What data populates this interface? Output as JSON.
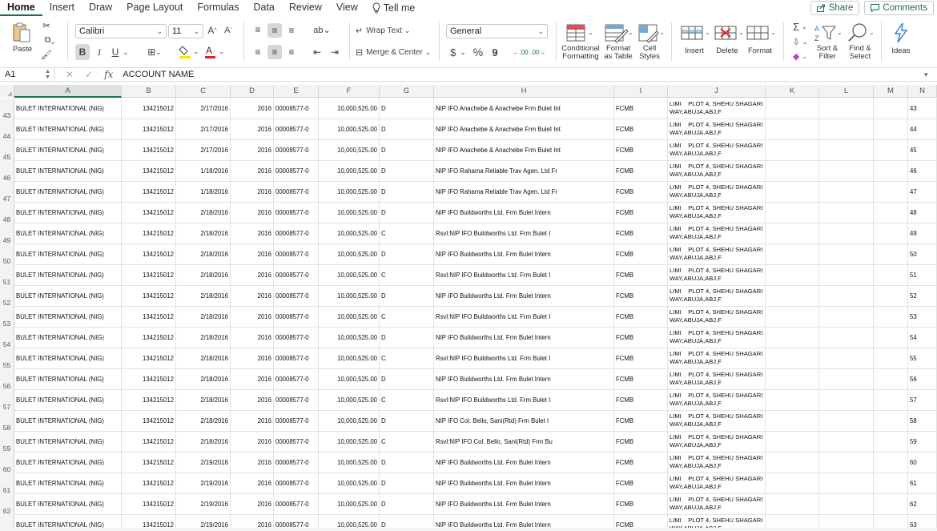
{
  "menu": {
    "tabs": [
      "Home",
      "Insert",
      "Draw",
      "Page Layout",
      "Formulas",
      "Data",
      "Review",
      "View"
    ],
    "tell_me": "Tell me",
    "share": "Share",
    "comments": "Comments"
  },
  "ribbon": {
    "paste": "Paste",
    "font_name": "Calibri",
    "font_size": "11",
    "wrap_text": "Wrap Text",
    "merge_center": "Merge & Center",
    "number_format": "General",
    "conditional_formatting_1": "Conditional",
    "conditional_formatting_2": "Formatting",
    "format_table_1": "Format",
    "format_table_2": "as Table",
    "cell_styles_1": "Cell",
    "cell_styles_2": "Styles",
    "insert": "Insert",
    "delete": "Delete",
    "format": "Format",
    "sort_filter_1": "Sort &",
    "sort_filter_2": "Filter",
    "find_select_1": "Find &",
    "find_select_2": "Select",
    "ideas": "Ideas",
    "bold": "B",
    "italic": "I",
    "underline": "U",
    "currency": "$",
    "percent": "%",
    "comma": "9"
  },
  "formula_bar": {
    "cell_ref": "A1",
    "fx": "fx",
    "content": "ACCOUNT NAME"
  },
  "columns": [
    "A",
    "B",
    "C",
    "D",
    "E",
    "F",
    "G",
    "H",
    "I",
    "J",
    "K",
    "L",
    "M",
    "N"
  ],
  "rows": [
    {
      "n": "43",
      "a": "BULET INTERNATIONAL (NIG)",
      "b": "134215012",
      "c": "2/17/2016",
      "d": "2016",
      "e": "00008577-0",
      "f": "10,000,525.00",
      "g": "D",
      "h": "NIP IFO Anachebe & Anachebe Frm Bulet Int",
      "i": "FCMB",
      "j1": "LIMI    PLOT 4, SHEHU SHAGARI",
      "j2": "WAY,ABUJA,ABJ,F"
    },
    {
      "n": "44",
      "a": "BULET INTERNATIONAL (NIG)",
      "b": "134215012",
      "c": "2/17/2016",
      "d": "2016",
      "e": "00008577-0",
      "f": "10,000,525.00",
      "g": "D",
      "h": "NIP IFO Anachebe & Anachebe Frm Bulet Int",
      "i": "FCMB",
      "j1": "LIMI    PLOT 4, SHEHU SHAGARI",
      "j2": "WAY,ABUJA,ABJ,F"
    },
    {
      "n": "45",
      "a": "BULET INTERNATIONAL (NIG)",
      "b": "134215012",
      "c": "2/17/2016",
      "d": "2016",
      "e": "00008577-0",
      "f": "10,000,525.00",
      "g": "D",
      "h": "NIP IFO Anachebe & Anachebe Frm Bulet Int",
      "i": "FCMB",
      "j1": "LIMI    PLOT 4, SHEHU SHAGARI",
      "j2": "WAY,ABUJA,ABJ,F"
    },
    {
      "n": "46",
      "a": "BULET INTERNATIONAL (NIG)",
      "b": "134215012",
      "c": "1/18/2016",
      "d": "2016",
      "e": "00008577-0",
      "f": "10,000,525.00",
      "g": "D",
      "h": "NIP IFO Rahama Reliable Trav Agen. Ltd Fr",
      "i": "FCMB",
      "j1": "LIMI    PLOT 4, SHEHU SHAGARI",
      "j2": "WAY,ABUJA,ABJ,F"
    },
    {
      "n": "47",
      "a": "BULET INTERNATIONAL (NIG)",
      "b": "134215012",
      "c": "1/18/2016",
      "d": "2016",
      "e": "00008577-0",
      "f": "10,000,525.00",
      "g": "D",
      "h": "NIP IFO Rahama Reliable Trav Agen. Ltd Fr",
      "i": "FCMB",
      "j1": "LIMI    PLOT 4, SHEHU SHAGARI",
      "j2": "WAY,ABUJA,ABJ,F"
    },
    {
      "n": "48",
      "a": "BULET INTERNATIONAL (NIG)",
      "b": "134215012",
      "c": "2/18/2016",
      "d": "2016",
      "e": "00008577-0",
      "f": "10,000,525.00",
      "g": "D",
      "h": "NIP IFO Buildworths Ltd. Frm Bulet Intern",
      "i": "FCMB",
      "j1": "LIMI    PLOT 4, SHEHU SHAGARI",
      "j2": "WAY,ABUJA,ABJ,F"
    },
    {
      "n": "49",
      "a": "BULET INTERNATIONAL (NIG)",
      "b": "134215012",
      "c": "2/18/2016",
      "d": "2016",
      "e": "00008577-0",
      "f": "10,000,525.00",
      "g": "C",
      "h": "Rsvl:NIP IFO Buildworths Ltd. Frm Bulet I",
      "i": "FCMB",
      "j1": "LIMI    PLOT 4, SHEHU SHAGARI",
      "j2": "WAY,ABUJA,ABJ,F"
    },
    {
      "n": "50",
      "a": "BULET INTERNATIONAL (NIG)",
      "b": "134215012",
      "c": "2/18/2016",
      "d": "2016",
      "e": "00008577-0",
      "f": "10,000,525.00",
      "g": "D",
      "h": "NIP IFO Buildworths Ltd. Frm Bulet Intern",
      "i": "FCMB",
      "j1": "LIMI    PLOT 4, SHEHU SHAGARI",
      "j2": "WAY,ABUJA,ABJ,F"
    },
    {
      "n": "51",
      "a": "BULET INTERNATIONAL (NIG)",
      "b": "134215012",
      "c": "2/18/2016",
      "d": "2016",
      "e": "00008577-0",
      "f": "10,000,525.00",
      "g": "C",
      "h": "Rsvl:NIP IFO Buildworths Ltd. Frm Bulet I",
      "i": "FCMB",
      "j1": "LIMI    PLOT 4, SHEHU SHAGARI",
      "j2": "WAY,ABUJA,ABJ,F"
    },
    {
      "n": "52",
      "a": "BULET INTERNATIONAL (NIG)",
      "b": "134215012",
      "c": "2/18/2016",
      "d": "2016",
      "e": "00008577-0",
      "f": "10,000,525.00",
      "g": "D",
      "h": "NIP IFO Buildworths Ltd. Frm Bulet Intern",
      "i": "FCMB",
      "j1": "LIMI    PLOT 4, SHEHU SHAGARI",
      "j2": "WAY,ABUJA,ABJ,F"
    },
    {
      "n": "53",
      "a": "BULET INTERNATIONAL (NIG)",
      "b": "134215012",
      "c": "2/18/2016",
      "d": "2016",
      "e": "00008577-0",
      "f": "10,000,525.00",
      "g": "C",
      "h": "Rsvl:NIP IFO Buildworths Ltd. Frm Bulet I",
      "i": "FCMB",
      "j1": "LIMI    PLOT 4, SHEHU SHAGARI",
      "j2": "WAY,ABUJA,ABJ,F"
    },
    {
      "n": "54",
      "a": "BULET INTERNATIONAL (NIG)",
      "b": "134215012",
      "c": "2/18/2016",
      "d": "2016",
      "e": "00008577-0",
      "f": "10,000,525.00",
      "g": "D",
      "h": "NIP IFO Buildworths Ltd. Frm Bulet Intern",
      "i": "FCMB",
      "j1": "LIMI    PLOT 4, SHEHU SHAGARI",
      "j2": "WAY,ABUJA,ABJ,F"
    },
    {
      "n": "55",
      "a": "BULET INTERNATIONAL (NIG)",
      "b": "134215012",
      "c": "2/18/2016",
      "d": "2016",
      "e": "00008577-0",
      "f": "10,000,525.00",
      "g": "C",
      "h": "Rsvl:NIP IFO Buildworths Ltd. Frm Bulet I",
      "i": "FCMB",
      "j1": "LIMI    PLOT 4, SHEHU SHAGARI",
      "j2": "WAY,ABUJA,ABJ,F"
    },
    {
      "n": "56",
      "a": "BULET INTERNATIONAL (NIG)",
      "b": "134215012",
      "c": "2/18/2016",
      "d": "2016",
      "e": "00008577-0",
      "f": "10,000,525.00",
      "g": "D",
      "h": "NIP IFO Buildworths Ltd. Frm Bulet Intern",
      "i": "FCMB",
      "j1": "LIMI    PLOT 4, SHEHU SHAGARI",
      "j2": "WAY,ABUJA,ABJ,F"
    },
    {
      "n": "57",
      "a": "BULET INTERNATIONAL (NIG)",
      "b": "134215012",
      "c": "2/18/2016",
      "d": "2016",
      "e": "00008577-0",
      "f": "10,000,525.00",
      "g": "C",
      "h": "Rsvl:NIP IFO Buildworths Ltd. Frm Bulet I",
      "i": "FCMB",
      "j1": "LIMI    PLOT 4, SHEHU SHAGARI",
      "j2": "WAY,ABUJA,ABJ,F"
    },
    {
      "n": "58",
      "a": "BULET INTERNATIONAL (NIG)",
      "b": "134215012",
      "c": "2/18/2016",
      "d": "2016",
      "e": "00008577-0",
      "f": "10,000,525.00",
      "g": "D",
      "h": "NIP IFO Col. Bello, Sani(Rtd) Frm Bulet I",
      "i": "FCMB",
      "j1": "LIMI    PLOT 4, SHEHU SHAGARI",
      "j2": "WAY,ABUJA,ABJ,F"
    },
    {
      "n": "59",
      "a": "BULET INTERNATIONAL (NIG)",
      "b": "134215012",
      "c": "2/18/2016",
      "d": "2016",
      "e": "00008577-0",
      "f": "10,000,525.00",
      "g": "C",
      "h": "Rsvl:NIP IFO Col. Bello, Sani(Rtd) Frm Bu",
      "i": "FCMB",
      "j1": "LIMI    PLOT 4, SHEHU SHAGARI",
      "j2": "WAY,ABUJA,ABJ,F"
    },
    {
      "n": "60",
      "a": "BULET INTERNATIONAL (NIG)",
      "b": "134215012",
      "c": "2/19/2016",
      "d": "2016",
      "e": "00008577-0",
      "f": "10,000,525.00",
      "g": "D",
      "h": "NIP IFO Buildworths Ltd. Frm Bulet Intern",
      "i": "FCMB",
      "j1": "LIMI    PLOT 4, SHEHU SHAGARI",
      "j2": "WAY,ABUJA,ABJ,F"
    },
    {
      "n": "61",
      "a": "BULET INTERNATIONAL (NIG)",
      "b": "134215012",
      "c": "2/19/2016",
      "d": "2016",
      "e": "00008577-0",
      "f": "10,000,525.00",
      "g": "D",
      "h": "NIP IFO Buildworths Ltd. Frm Bulet Intern",
      "i": "FCMB",
      "j1": "LIMI    PLOT 4, SHEHU SHAGARI",
      "j2": "WAY,ABUJA,ABJ,F"
    },
    {
      "n": "62",
      "a": "BULET INTERNATIONAL (NIG)",
      "b": "134215012",
      "c": "2/19/2016",
      "d": "2016",
      "e": "00008577-0",
      "f": "10,000,525.00",
      "g": "D",
      "h": "NIP IFO Buildworths Ltd. Frm Bulet Intern",
      "i": "FCMB",
      "j1": "LIMI    PLOT 4, SHEHU SHAGARI",
      "j2": "WAY,ABUJA,ABJ,F"
    },
    {
      "n": "63",
      "a": "BULET INTERNATIONAL (NIG)",
      "b": "134215012",
      "c": "2/19/2016",
      "d": "2016",
      "e": "00008577-0",
      "f": "10,000,525.00",
      "g": "D",
      "h": "NIP IFO Buildworths Ltd. Frm Bulet Intern",
      "i": "FCMB",
      "j1": "LIMI    PLOT 4, SHEHU SHAGARI",
      "j2": "WAY,ABUJA,ABJ,F"
    }
  ],
  "colors": {
    "accent": "#1e7145",
    "font_color_bar": "#e02020",
    "highlight_bar": "#ffe600",
    "ideas_icon": "#2f7bd9"
  }
}
